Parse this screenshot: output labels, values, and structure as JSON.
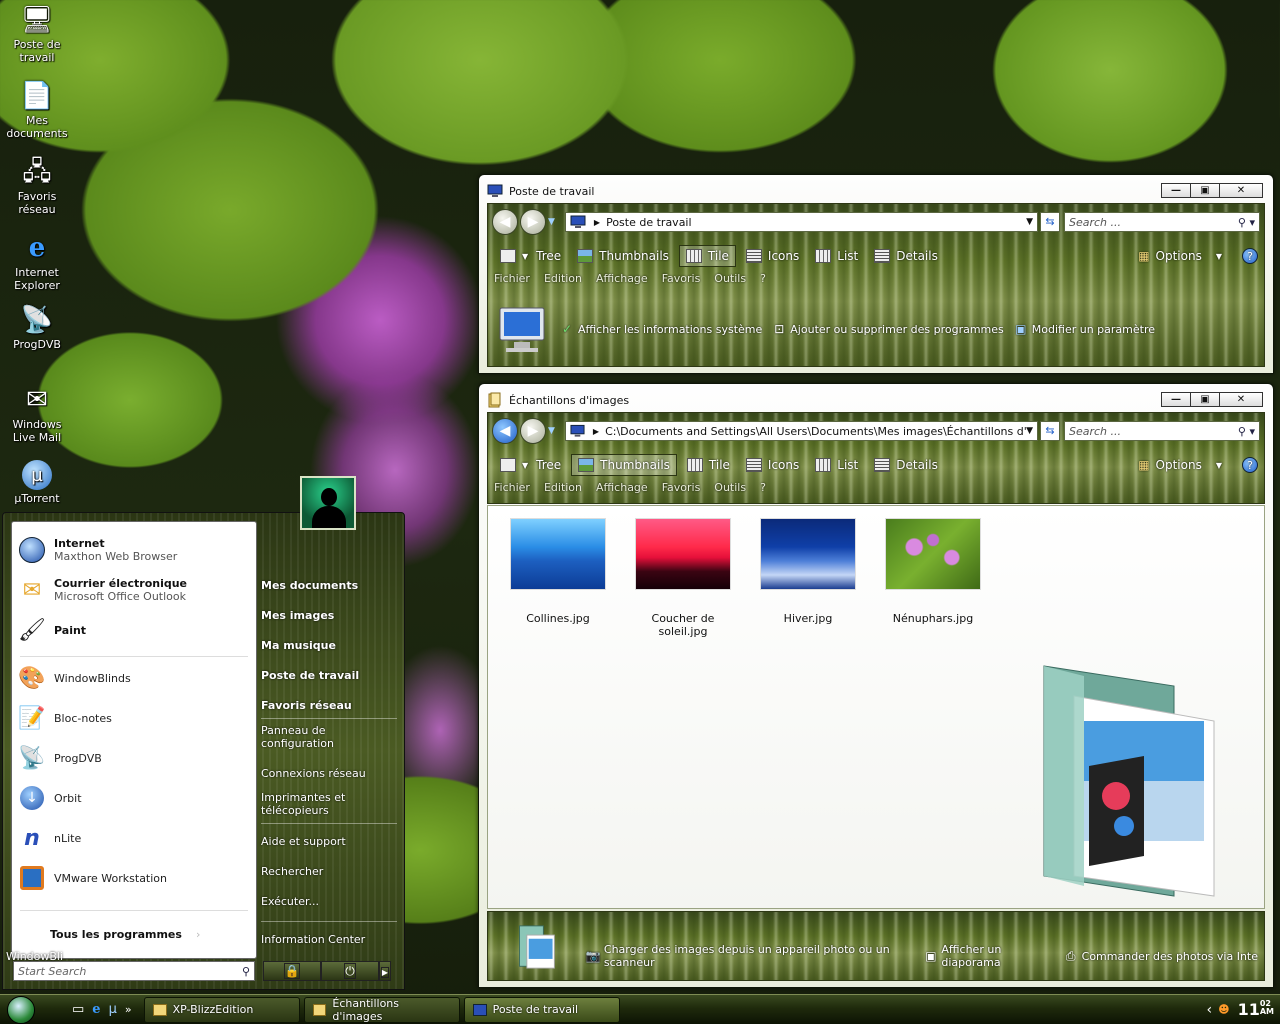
{
  "desktop": {
    "icons": [
      {
        "label": "Poste de travail",
        "icon": "computer-icon"
      },
      {
        "label": "Mes documents",
        "icon": "documents-icon"
      },
      {
        "label": "Favoris réseau",
        "icon": "network-icon"
      },
      {
        "label": "Internet Explorer",
        "icon": "ie-icon"
      },
      {
        "label": "ProgDVB",
        "icon": "satellite-icon"
      },
      {
        "label": "Windows Live Mail",
        "icon": "mail-icon"
      },
      {
        "label": "µTorrent",
        "icon": "utorrent-icon"
      }
    ]
  },
  "win1": {
    "title": "Poste de travail",
    "address": "Poste de travail",
    "search_placeholder": "Search ...",
    "toolbar": [
      "Tree",
      "Thumbnails",
      "Tile",
      "Icons",
      "List",
      "Details"
    ],
    "selected_view": "Tile",
    "options": "Options",
    "help": "?",
    "menu": [
      "Fichier",
      "Edition",
      "Affichage",
      "Favoris",
      "Outils",
      "?"
    ],
    "tasks": [
      "Afficher les informations système",
      "Ajouter ou supprimer des programmes",
      "Modifier un paramètre"
    ]
  },
  "win2": {
    "title": "Échantillons d'images",
    "address": "C:\\Documents and Settings\\All Users\\Documents\\Mes images\\Échantillons d'imag",
    "search_placeholder": "Search ...",
    "toolbar": [
      "Tree",
      "Thumbnails",
      "Tile",
      "Icons",
      "List",
      "Details"
    ],
    "selected_view": "Thumbnails",
    "options": "Options",
    "help": "?",
    "menu": [
      "Fichier",
      "Edition",
      "Affichage",
      "Favoris",
      "Outils",
      "?"
    ],
    "files": [
      "Collines.jpg",
      "Coucher de soleil.jpg",
      "Hiver.jpg",
      "Nénuphars.jpg"
    ],
    "tasks": [
      "Charger des images depuis un appareil photo ou un scanneur",
      "Afficher un diaporama",
      "Commander des photos via Inte"
    ]
  },
  "startmenu": {
    "pinned": [
      {
        "title": "Internet",
        "sub": "Maxthon Web Browser"
      },
      {
        "title": "Courrier électronique",
        "sub": "Microsoft Office Outlook"
      },
      {
        "title": "Paint",
        "sub": ""
      }
    ],
    "recent": [
      "WindowBlinds",
      "Bloc-notes",
      "ProgDVB",
      "Orbit",
      "nLite",
      "VMware Workstation"
    ],
    "all_programs": "Tous les programmes",
    "right": [
      "Mes documents",
      "Mes images",
      "Ma musique",
      "Poste de travail",
      "Favoris réseau"
    ],
    "right2": [
      "Panneau de configuration",
      "Connexions réseau",
      "Imprimantes et télécopieurs"
    ],
    "right3": [
      "Aide et support",
      "Rechercher",
      "Exécuter..."
    ],
    "right4": [
      "Information Center"
    ],
    "search_placeholder": "Start Search",
    "overflow_label": "WindowBli"
  },
  "taskbar": {
    "buttons": [
      "XP-BlizzEdition",
      "Échantillons d'images",
      "Poste de travail"
    ],
    "clock_hour": "11",
    "clock_min": "02",
    "clock_ampm": "AM",
    "tray_arrow": "‹",
    "ql_more": "»"
  }
}
